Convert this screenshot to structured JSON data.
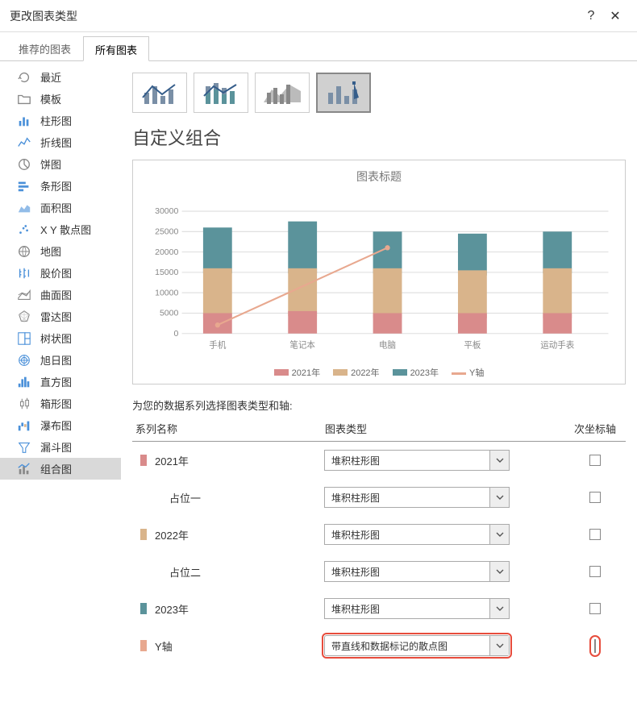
{
  "window": {
    "title": "更改图表类型",
    "help": "?",
    "close": "✕"
  },
  "tabs": {
    "recommended": "推荐的图表",
    "all": "所有图表"
  },
  "sidebar": {
    "items": [
      {
        "label": "最近"
      },
      {
        "label": "模板"
      },
      {
        "label": "柱形图"
      },
      {
        "label": "折线图"
      },
      {
        "label": "饼图"
      },
      {
        "label": "条形图"
      },
      {
        "label": "面积图"
      },
      {
        "label": "X Y 散点图"
      },
      {
        "label": "地图"
      },
      {
        "label": "股价图"
      },
      {
        "label": "曲面图"
      },
      {
        "label": "雷达图"
      },
      {
        "label": "树状图"
      },
      {
        "label": "旭日图"
      },
      {
        "label": "直方图"
      },
      {
        "label": "箱形图"
      },
      {
        "label": "瀑布图"
      },
      {
        "label": "漏斗图"
      },
      {
        "label": "组合图"
      }
    ]
  },
  "section_title": "自定义组合",
  "chart_preview_title": "图表标题",
  "legend": {
    "s1": "2021年",
    "s2": "2022年",
    "s3": "2023年",
    "s4": "Y轴"
  },
  "series_instruction": "为您的数据系列选择图表类型和轴:",
  "series_headers": {
    "name": "系列名称",
    "type": "图表类型",
    "axis": "次坐标轴"
  },
  "series_rows": [
    {
      "name": "2021年",
      "type": "堆积柱形图",
      "color": "#d98b8b"
    },
    {
      "name": "占位一",
      "type": "堆积柱形图",
      "color": ""
    },
    {
      "name": "2022年",
      "type": "堆积柱形图",
      "color": "#d9b48b"
    },
    {
      "name": "占位二",
      "type": "堆积柱形图",
      "color": ""
    },
    {
      "name": "2023年",
      "type": "堆积柱形图",
      "color": "#5b939b"
    },
    {
      "name": "Y轴",
      "type": "带直线和数据标记的散点图",
      "color": "#e8a88f"
    }
  ],
  "colors": {
    "c1": "#d98b8b",
    "c2": "#d9b48b",
    "c3": "#5b939b",
    "c4": "#e8a88f",
    "highlight": "#e74c3c"
  },
  "chart_data": {
    "type": "bar",
    "title": "图表标题",
    "categories": [
      "手机",
      "笔记本",
      "电脑",
      "平板",
      "运动手表"
    ],
    "series": [
      {
        "name": "2021年",
        "values": [
          5000,
          5500,
          5000,
          5000,
          5000
        ]
      },
      {
        "name": "2022年",
        "values": [
          16000,
          16000,
          16000,
          15500,
          16000
        ]
      },
      {
        "name": "2023年",
        "values": [
          26000,
          27500,
          25000,
          24500,
          25000
        ]
      }
    ],
    "line_series": {
      "name": "Y轴",
      "x": [
        0,
        2
      ],
      "y": [
        2000,
        21000
      ]
    },
    "ylim": [
      0,
      30000
    ],
    "yticks": [
      0,
      5000,
      10000,
      15000,
      20000,
      25000,
      30000
    ],
    "xlabel": "",
    "ylabel": ""
  }
}
